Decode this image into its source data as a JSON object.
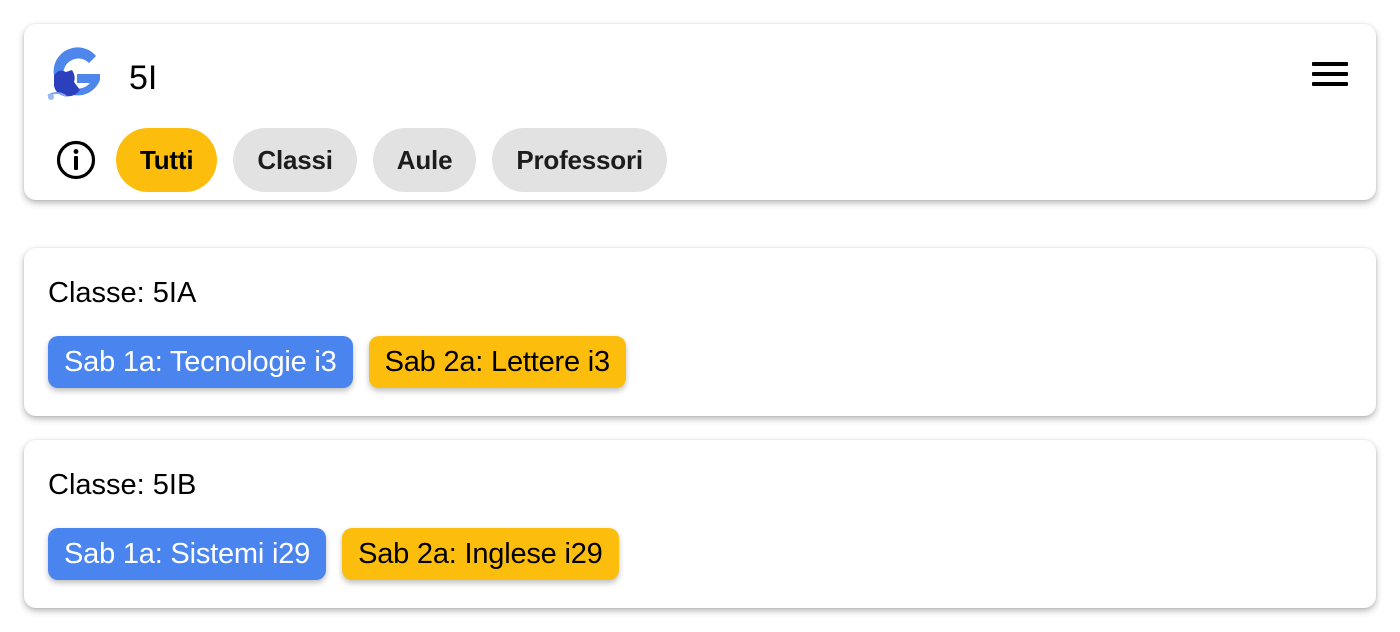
{
  "header": {
    "search_text": "5I",
    "logo_icon": "app-logo-g-icon",
    "menu_icon": "hamburger-menu-icon"
  },
  "filters": {
    "info_icon": "info-circle-icon",
    "chips": [
      {
        "label": "Tutti",
        "active": true
      },
      {
        "label": "Classi",
        "active": false
      },
      {
        "label": "Aule",
        "active": false
      },
      {
        "label": "Professori",
        "active": false
      }
    ]
  },
  "results": [
    {
      "title": "Classe: 5IA",
      "tags": [
        {
          "label": "Sab 1a: Tecnologie i3",
          "color": "#4a84ee"
        },
        {
          "label": "Sab 2a: Lettere i3",
          "color": "#fdbd0d"
        }
      ]
    },
    {
      "title": "Classe: 5IB",
      "tags": [
        {
          "label": "Sab 1a: Sistemi i29",
          "color": "#4a84ee"
        },
        {
          "label": "Sab 2a: Inglese i29",
          "color": "#fdbd0d"
        }
      ]
    }
  ],
  "colors": {
    "accent_yellow": "#fdbd0d",
    "accent_blue": "#4a84ee",
    "chip_gray": "#e2e2e2"
  }
}
